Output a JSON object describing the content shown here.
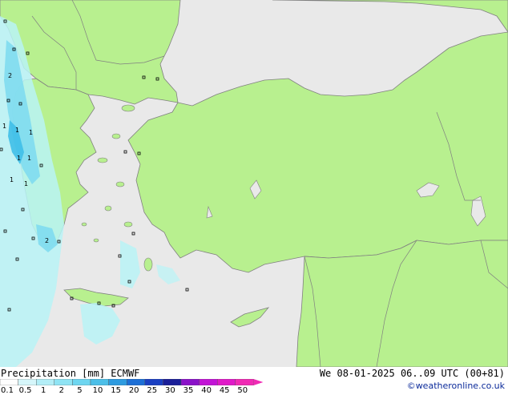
{
  "map": {
    "colors": {
      "sea": "#e9e9e9",
      "land": "#b8f08f",
      "border": "#808080",
      "precip_light": "#b8f3f6",
      "precip_mid": "#7fdcf0",
      "precip_high": "#3fbfe8"
    },
    "station_values": [
      "2",
      "1",
      "1",
      "1",
      "1",
      "1",
      "1",
      "1",
      "2"
    ]
  },
  "footer": {
    "title": "Precipitation [mm]  ECMWF",
    "valid_time": "We 08-01-2025 06..09 UTC (00+81)",
    "credit": "©weatheronline.co.uk"
  },
  "legend": {
    "ticks": [
      "0.1",
      "0.5",
      "1",
      "2",
      "5",
      "10",
      "15",
      "20",
      "25",
      "30",
      "35",
      "40",
      "45",
      "50"
    ],
    "colors": [
      "#fefefe",
      "#d6f6fa",
      "#b3eef7",
      "#8fe4f4",
      "#6ed6f0",
      "#4cbfe8",
      "#2e9be0",
      "#1d6fd6",
      "#1a3fc2",
      "#1a1e98",
      "#8a12c8",
      "#c214d6",
      "#e01ac8",
      "#f02ab4"
    ]
  }
}
